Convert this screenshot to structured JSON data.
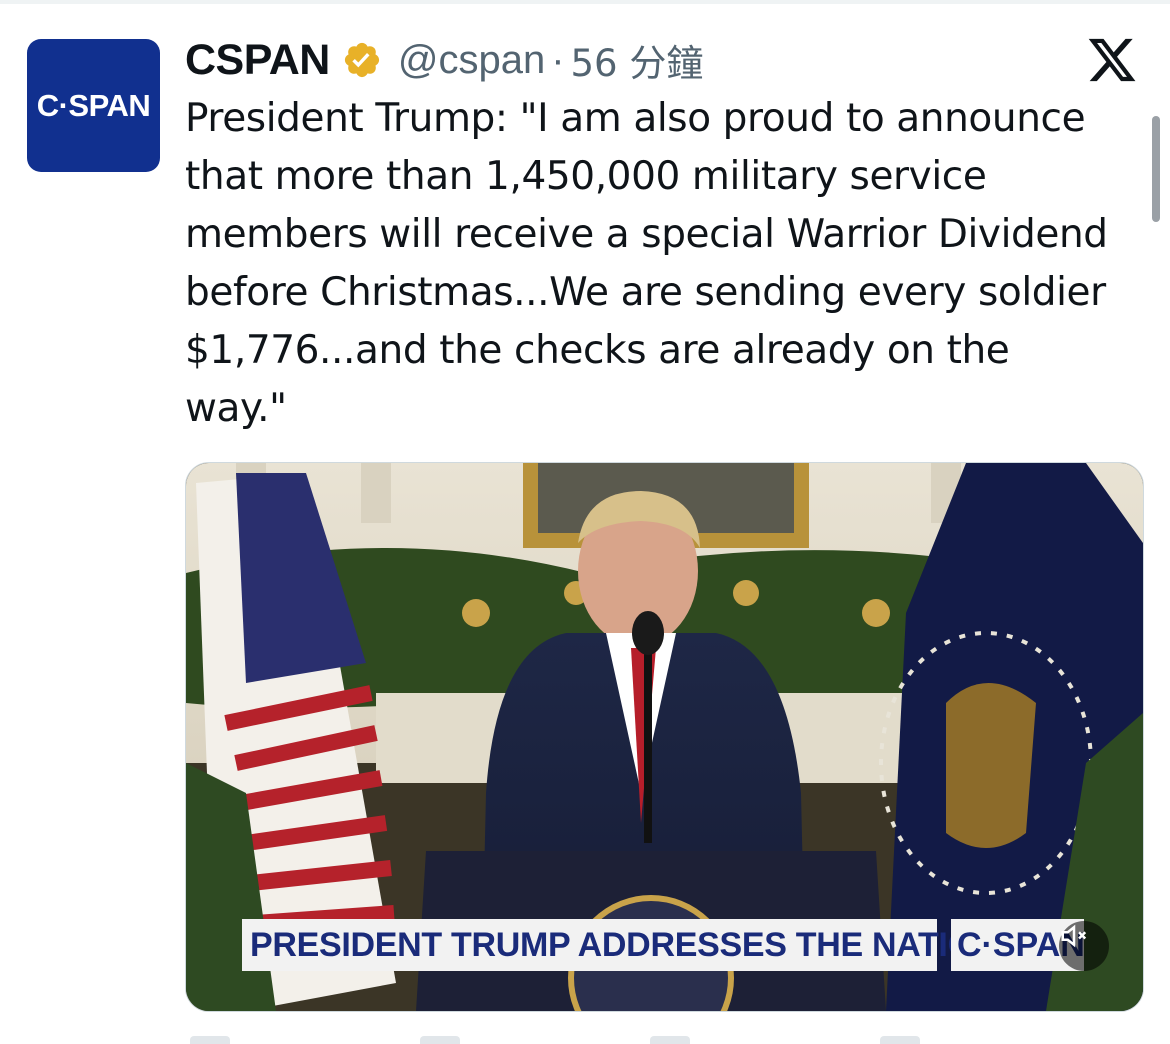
{
  "tweet": {
    "avatar_text": "C·SPAN",
    "display_name": "CSPAN",
    "verified_icon": "verified-badge-gold-icon",
    "handle": "@cspan",
    "separator": "·",
    "timestamp": "56 分鐘",
    "platform_icon": "x-logo-icon",
    "text": "President Trump: \"I am also proud to announce\nthat more than 1,450,000 military service\nmembers will receive a special Warrior Dividend\nbefore Christmas...We are sending every soldier\n$1,776...and the checks are already on the\nway.\""
  },
  "media": {
    "type": "video",
    "chyron_text": "PRESIDENT TRUMP ADDRESSES THE NATION",
    "chyron_logo": "C·SPAN",
    "mute_icon": "volume-muted-icon"
  },
  "colors": {
    "brand_blue": "#11308f",
    "verified_gold": "#e8b128",
    "secondary_text": "#536471"
  }
}
